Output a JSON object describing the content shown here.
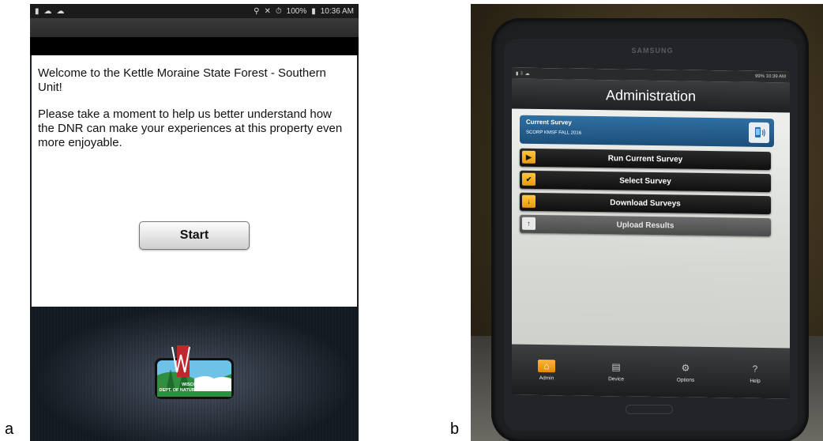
{
  "labels": {
    "a": "a",
    "b": "b"
  },
  "panel_a": {
    "status_time": "10:36 AM",
    "status_battery": "100%",
    "welcome_text": "Welcome to the Kettle Moraine State Forest - Southern Unit!",
    "body_text": "Please take a moment to help us better understand how the DNR can make your experiences at this property even more enjoyable.",
    "start_label": "Start",
    "logo_line1": "WISCONSIN",
    "logo_line2": "DEPT. OF NATURAL RESOURCES",
    "logo_letter": "W"
  },
  "panel_b": {
    "brand": "SAMSUNG",
    "status_time": "10:39 AM",
    "status_battery": "99%",
    "title": "Administration",
    "current_survey_label": "Current Survey",
    "current_survey_name": "SCORP KMSF FALL 2016",
    "menu": [
      {
        "label": "Run Current Survey",
        "icon": "play-icon"
      },
      {
        "label": "Select Survey",
        "icon": "check-icon"
      },
      {
        "label": "Download Surveys",
        "icon": "download-arrow-icon"
      },
      {
        "label": "Upload Results",
        "icon": "upload-arrow-icon"
      }
    ],
    "nav": [
      {
        "label": "Admin",
        "icon": "home-icon"
      },
      {
        "label": "Device",
        "icon": "device-icon"
      },
      {
        "label": "Options",
        "icon": "gear-icon"
      },
      {
        "label": "Help",
        "icon": "question-icon"
      }
    ]
  }
}
